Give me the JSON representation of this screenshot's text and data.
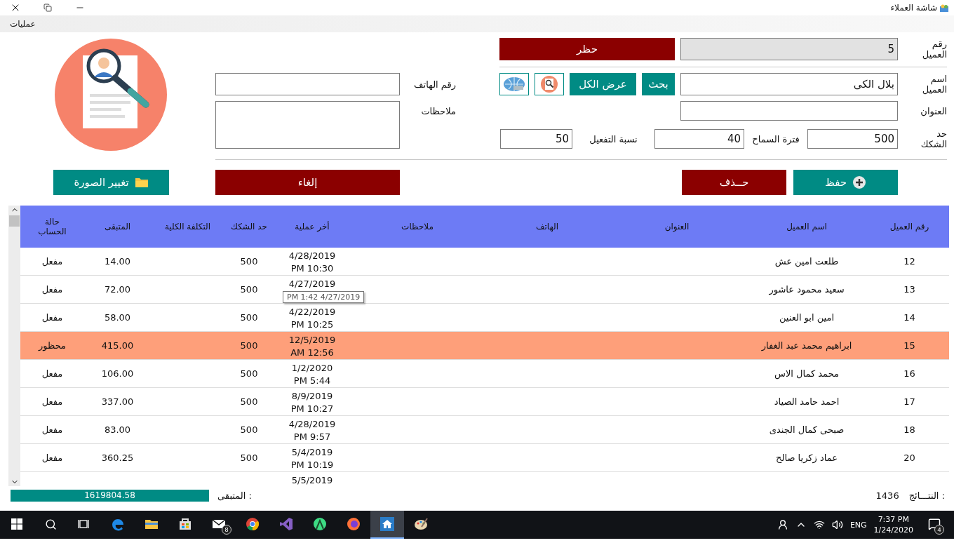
{
  "window": {
    "title": "شاشة العملاء",
    "menu": [
      "عمليات"
    ]
  },
  "form": {
    "customer_id": {
      "label": "رقم العميل",
      "value": "5",
      "disabled": true
    },
    "block_button": "حظر",
    "name": {
      "label": "اسم العميل",
      "value": "بلال الكى"
    },
    "search_button": "بحث",
    "show_all_button": "عرض الكل",
    "phone": {
      "label": "رقم الهاتف"
    },
    "address": {
      "label": "العنوان"
    },
    "notes": {
      "label": "ملاحظات"
    },
    "credit_limit": {
      "label": "حد الشكك",
      "value": "500"
    },
    "grace_period": {
      "label": "فترة السماح",
      "value": "40"
    },
    "activation_rate": {
      "label": "نسبة التفعيل",
      "value": "50"
    },
    "buttons": [
      {
        "label": "حفظ",
        "kind": "save"
      },
      {
        "label": "حــذف",
        "kind": "delete"
      },
      {
        "label": "إلغاء",
        "kind": "cancel"
      },
      {
        "label": "تغيير الصورة",
        "kind": "image"
      }
    ]
  },
  "table": {
    "columns": [
      "رقم العميل",
      "اسم العميل",
      "العنوان",
      "الهاتف",
      "ملاحظات",
      "أخر عملية",
      "حد الشكك",
      "التكلفة الكلية",
      "المتبقى",
      "حالة الحساب"
    ],
    "rows": [
      {
        "id": "12",
        "name": "طلعت امين عش",
        "last_op": [
          "4/28/2019",
          "PM 10:30"
        ],
        "limit": "500",
        "remaining": "14.00",
        "status": "مفعل",
        "blocked": false
      },
      {
        "id": "13",
        "name": "سعيد محمود عاشور",
        "last_op": [
          "4/27/2019"
        ],
        "limit": "500",
        "remaining": "72.00",
        "status": "مفعل",
        "blocked": false
      },
      {
        "id": "14",
        "name": "امين ابو العنين",
        "last_op": [
          "4/22/2019",
          "PM 10:25"
        ],
        "limit": "500",
        "remaining": "58.00",
        "status": "مفعل",
        "blocked": false
      },
      {
        "id": "15",
        "name": "ابراهيم محمد عبد الغفار",
        "last_op": [
          "12/5/2019",
          "AM 12:56"
        ],
        "limit": "500",
        "remaining": "415.00",
        "status": "محظور",
        "blocked": true
      },
      {
        "id": "16",
        "name": "محمد كمال الاس",
        "last_op": [
          "1/2/2020",
          "PM 5:44"
        ],
        "limit": "500",
        "remaining": "106.00",
        "status": "مفعل",
        "blocked": false
      },
      {
        "id": "17",
        "name": "احمد حامد الصياد",
        "last_op": [
          "8/9/2019",
          "PM 10:27"
        ],
        "limit": "500",
        "remaining": "337.00",
        "status": "مفعل",
        "blocked": false
      },
      {
        "id": "18",
        "name": "صبحى كمال الجندى",
        "last_op": [
          "4/28/2019",
          "PM 9:57"
        ],
        "limit": "500",
        "remaining": "83.00",
        "status": "مفعل",
        "blocked": false
      },
      {
        "id": "20",
        "name": "عماد زكريا صالح",
        "last_op": [
          "5/4/2019",
          "PM 10:19"
        ],
        "limit": "500",
        "remaining": "360.25",
        "status": "مفعل",
        "blocked": false
      },
      {
        "last_op": [
          "5/5/2019"
        ],
        "blocked": false
      }
    ],
    "tooltip": "PM 1:42 4/27/2019"
  },
  "footer": {
    "results_label": "النتـــائج :",
    "results": "1436",
    "remaining_label": "المتبقى :",
    "remaining": "1619804.58"
  },
  "taskbar": {
    "apps": [
      {
        "kind": "edge",
        "selected": false
      },
      {
        "kind": "folder",
        "selected": false
      },
      {
        "kind": "store",
        "selected": false
      },
      {
        "kind": "mail",
        "selected": false,
        "badge": "8"
      },
      {
        "kind": "chrome",
        "selected": false
      },
      {
        "kind": "studio",
        "selected": false
      },
      {
        "kind": "android",
        "selected": false
      },
      {
        "kind": "firefox",
        "selected": false
      },
      {
        "kind": "home",
        "selected": true
      },
      {
        "kind": "paint",
        "selected": false
      }
    ],
    "language": "ENG",
    "time": "7:37 PM",
    "date": "1/24/2020",
    "notifications": "4"
  }
}
